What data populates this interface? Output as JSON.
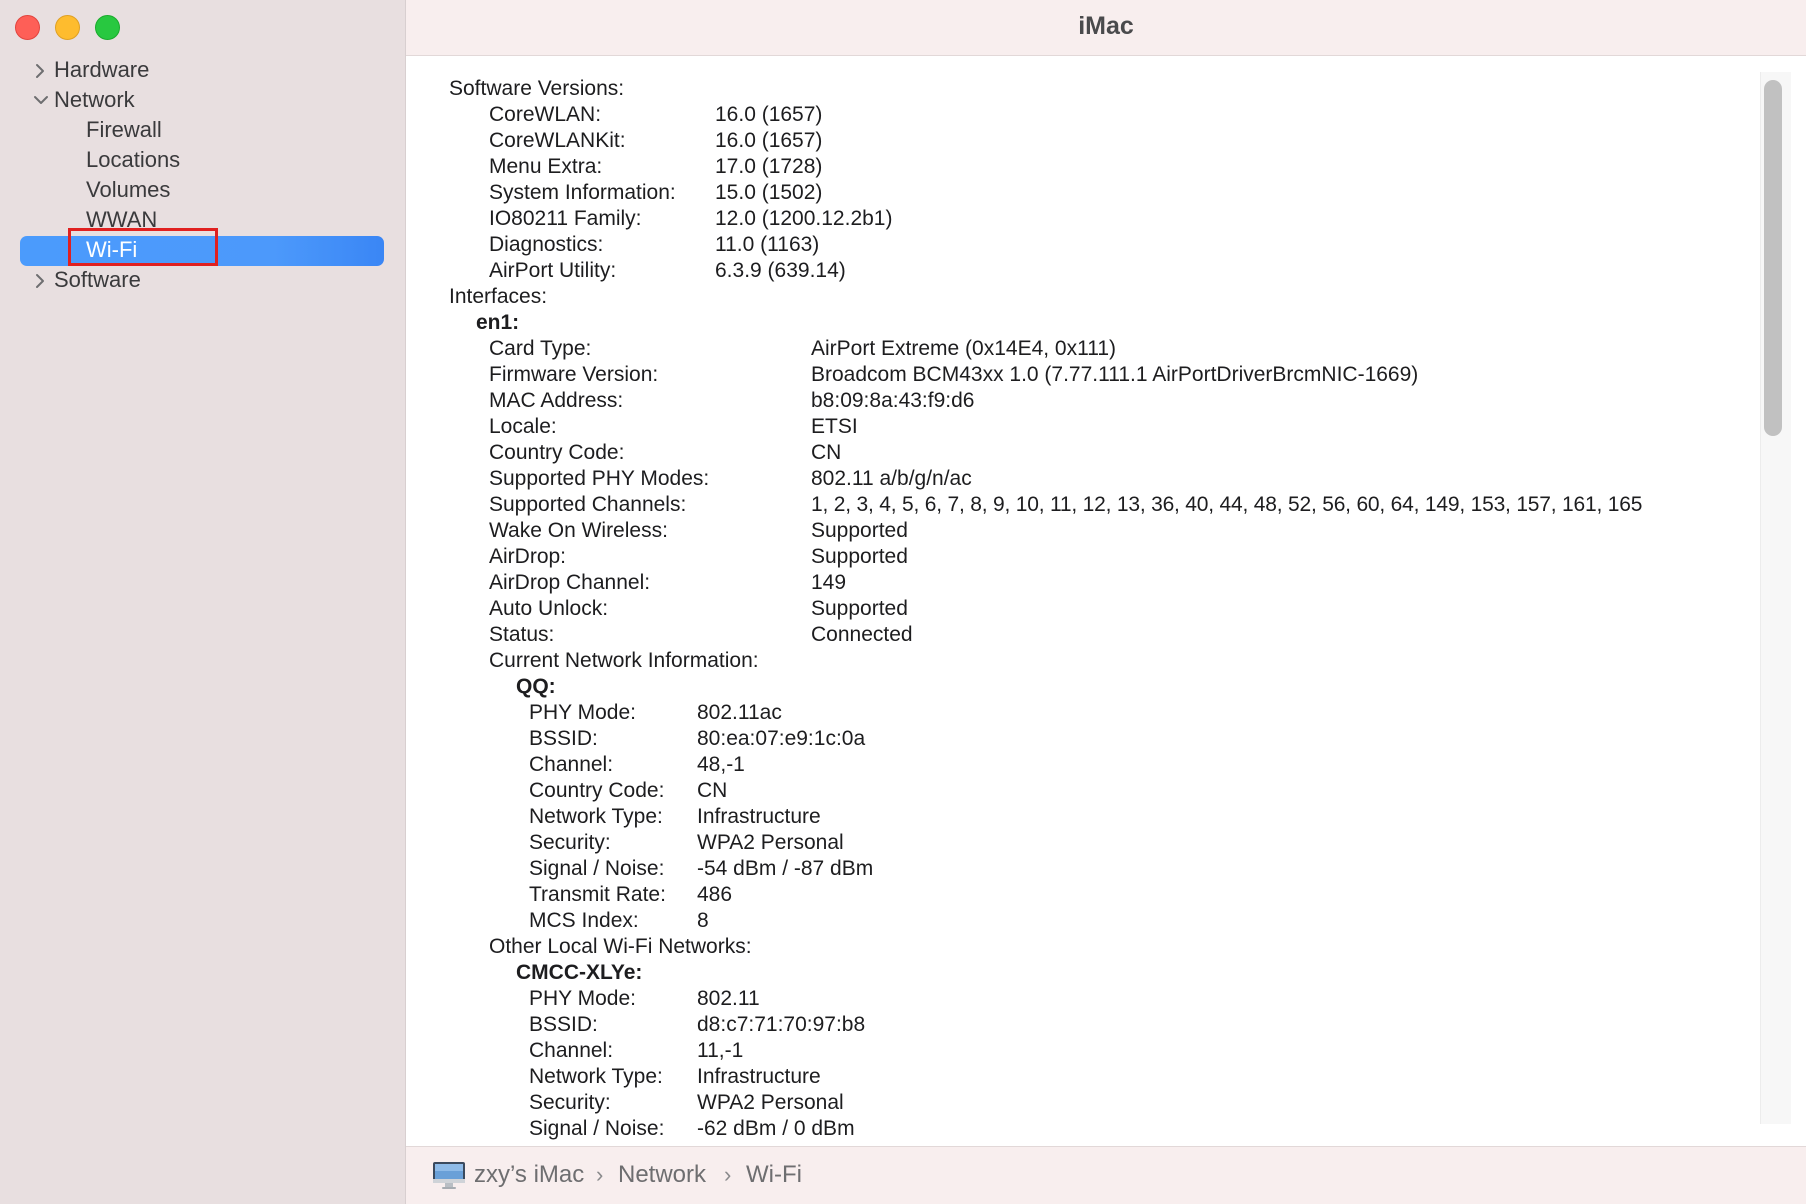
{
  "window": {
    "title": "iMac"
  },
  "sidebar": {
    "items": [
      {
        "label": "Hardware",
        "expanded": false
      },
      {
        "label": "Network",
        "expanded": true
      },
      {
        "label": "Firewall"
      },
      {
        "label": "Locations"
      },
      {
        "label": "Volumes"
      },
      {
        "label": "WWAN"
      },
      {
        "label": "Wi-Fi",
        "selected": true
      },
      {
        "label": "Software",
        "expanded": false
      }
    ]
  },
  "content": {
    "software_versions_header": "Software Versions:",
    "software_versions": [
      {
        "k": "CoreWLAN:",
        "v": "16.0 (1657)"
      },
      {
        "k": "CoreWLANKit:",
        "v": "16.0 (1657)"
      },
      {
        "k": "Menu Extra:",
        "v": "17.0 (1728)"
      },
      {
        "k": "System Information:",
        "v": "15.0 (1502)"
      },
      {
        "k": "IO80211 Family:",
        "v": "12.0 (1200.12.2b1)"
      },
      {
        "k": "Diagnostics:",
        "v": "11.0 (1163)"
      },
      {
        "k": "AirPort Utility:",
        "v": "6.3.9 (639.14)"
      }
    ],
    "interfaces_header": "Interfaces:",
    "interface_name": "en1:",
    "interface_props": [
      {
        "k": "Card Type:",
        "v": "AirPort Extreme  (0x14E4, 0x111)"
      },
      {
        "k": "Firmware Version:",
        "v": "Broadcom BCM43xx 1.0 (7.77.111.1 AirPortDriverBrcmNIC-1669)"
      },
      {
        "k": "MAC Address:",
        "v": "b8:09:8a:43:f9:d6"
      },
      {
        "k": "Locale:",
        "v": "ETSI"
      },
      {
        "k": "Country Code:",
        "v": "CN"
      },
      {
        "k": "Supported PHY Modes:",
        "v": "802.11 a/b/g/n/ac"
      },
      {
        "k": "Supported Channels:",
        "v": "1, 2, 3, 4, 5, 6, 7, 8, 9, 10, 11, 12, 13, 36, 40, 44, 48, 52, 56, 60, 64, 149, 153, 157, 161, 165"
      },
      {
        "k": "Wake On Wireless:",
        "v": "Supported"
      },
      {
        "k": "AirDrop:",
        "v": "Supported"
      },
      {
        "k": "AirDrop Channel:",
        "v": "149"
      },
      {
        "k": "Auto Unlock:",
        "v": "Supported"
      },
      {
        "k": "Status:",
        "v": "Connected"
      }
    ],
    "current_network_header": "Current Network Information:",
    "current_network_name": "QQ:",
    "current_network_props": [
      {
        "k": "PHY Mode:",
        "v": "802.11ac"
      },
      {
        "k": "BSSID:",
        "v": "80:ea:07:e9:1c:0a"
      },
      {
        "k": "Channel:",
        "v": "48,-1"
      },
      {
        "k": "Country Code:",
        "v": "CN"
      },
      {
        "k": "Network Type:",
        "v": "Infrastructure"
      },
      {
        "k": "Security:",
        "v": "WPA2 Personal"
      },
      {
        "k": "Signal / Noise:",
        "v": "-54 dBm / -87 dBm"
      },
      {
        "k": "Transmit Rate:",
        "v": "486"
      },
      {
        "k": "MCS Index:",
        "v": "8"
      }
    ],
    "other_networks_header": "Other Local Wi-Fi Networks:",
    "other_network_name": "CMCC-XLYe:",
    "other_network_props": [
      {
        "k": "PHY Mode:",
        "v": "802.11"
      },
      {
        "k": "BSSID:",
        "v": "d8:c7:71:70:97:b8"
      },
      {
        "k": "Channel:",
        "v": "11,-1"
      },
      {
        "k": "Network Type:",
        "v": "Infrastructure"
      },
      {
        "k": "Security:",
        "v": "WPA2 Personal"
      },
      {
        "k": "Signal / Noise:",
        "v": "-62 dBm / 0 dBm"
      }
    ]
  },
  "pathbar": {
    "items": [
      "zxy’s iMac",
      "Network",
      "Wi-Fi"
    ],
    "separator": "›",
    "icon": "imac-icon"
  },
  "colors": {
    "sidebar_bg": "#e8dfe0",
    "selection": "#4b9bfc",
    "highlight_box": "#e02020",
    "titlebar_bg": "#f8eeee"
  }
}
